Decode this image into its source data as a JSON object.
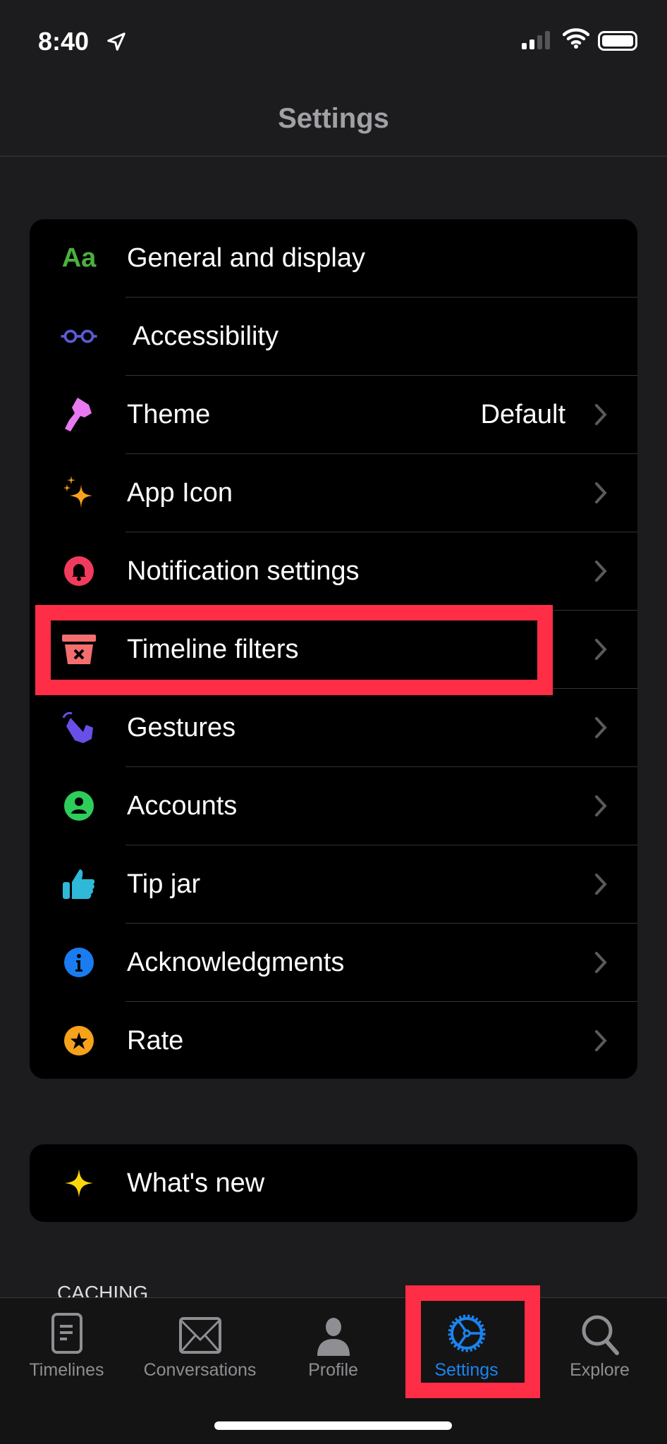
{
  "status_bar": {
    "time": "8:40",
    "location_icon": "location-arrow-icon",
    "signal_bars": 2,
    "battery_level": 0.9
  },
  "header": {
    "title": "Settings"
  },
  "settings_list": {
    "items": [
      {
        "label": "General and display",
        "icon": "text-size-icon",
        "icon_text": "Aa",
        "color": "#4caf3f",
        "chevron": false
      },
      {
        "label": "Accessibility",
        "icon": "glasses-icon",
        "color": "#5b5bd6",
        "chevron": false
      },
      {
        "label": "Theme",
        "value": "Default",
        "icon": "paintbrush-icon",
        "color": "#e879f0",
        "chevron": true
      },
      {
        "label": "App Icon",
        "icon": "sparkles-icon",
        "color": "#f7a21b",
        "chevron": true
      },
      {
        "label": "Notification settings",
        "icon": "bell-icon",
        "color": "#f23b5c",
        "chevron": true
      },
      {
        "label": "Timeline filters",
        "icon": "filter-bin-icon",
        "color": "#f36f6f",
        "chevron": true,
        "highlighted": true
      },
      {
        "label": "Gestures",
        "icon": "hand-tap-icon",
        "color": "#6a4ee8",
        "chevron": true
      },
      {
        "label": "Accounts",
        "icon": "person-circle-icon",
        "color": "#2ecc5b",
        "chevron": true
      },
      {
        "label": "Tip jar",
        "icon": "thumbs-up-icon",
        "color": "#2fb8d8",
        "chevron": true
      },
      {
        "label": "Acknowledgments",
        "icon": "info-circle-icon",
        "color": "#1a7cf0",
        "chevron": true
      },
      {
        "label": "Rate",
        "icon": "star-circle-icon",
        "color": "#f7a21b",
        "chevron": true
      }
    ]
  },
  "whats_new": {
    "label": "What's new",
    "icon": "sparkle-icon",
    "color": "#ffd60a"
  },
  "section_caching": {
    "label": "CACHING"
  },
  "tab_bar": {
    "active": "Settings",
    "accent": "#1a84f0",
    "tabs": [
      {
        "label": "Timelines",
        "icon": "timeline-icon"
      },
      {
        "label": "Conversations",
        "icon": "envelope-icon"
      },
      {
        "label": "Profile",
        "icon": "person-icon"
      },
      {
        "label": "Settings",
        "icon": "gear-icon"
      },
      {
        "label": "Explore",
        "icon": "search-icon"
      }
    ]
  },
  "highlight_color": "#ff2d45"
}
